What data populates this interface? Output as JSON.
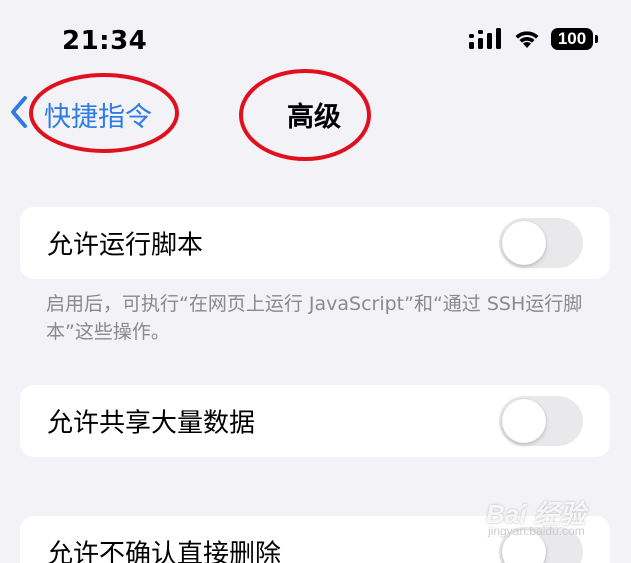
{
  "status_bar": {
    "time": "21:34",
    "battery": "100",
    "icons": [
      "cellular-signal-icon",
      "wifi-icon",
      "battery-icon"
    ]
  },
  "nav": {
    "back_label": "快捷指令",
    "title": "高级",
    "back_icon": "chevron-left-icon",
    "accent_color": "#2f7de1"
  },
  "settings": [
    {
      "label": "允许运行脚本",
      "enabled": false
    },
    {
      "label": "允许共享大量数据",
      "enabled": false
    },
    {
      "label": "允许不确认直接删除",
      "enabled": false
    }
  ],
  "footnote": "启用后，可执行“在网页上运行 JavaScript”和“通过 SSH运行脚本”这些操作。",
  "annotation_color": "#e0101e",
  "watermark": {
    "text": "Bai 经验",
    "url": "jingyan.baidu.com"
  }
}
